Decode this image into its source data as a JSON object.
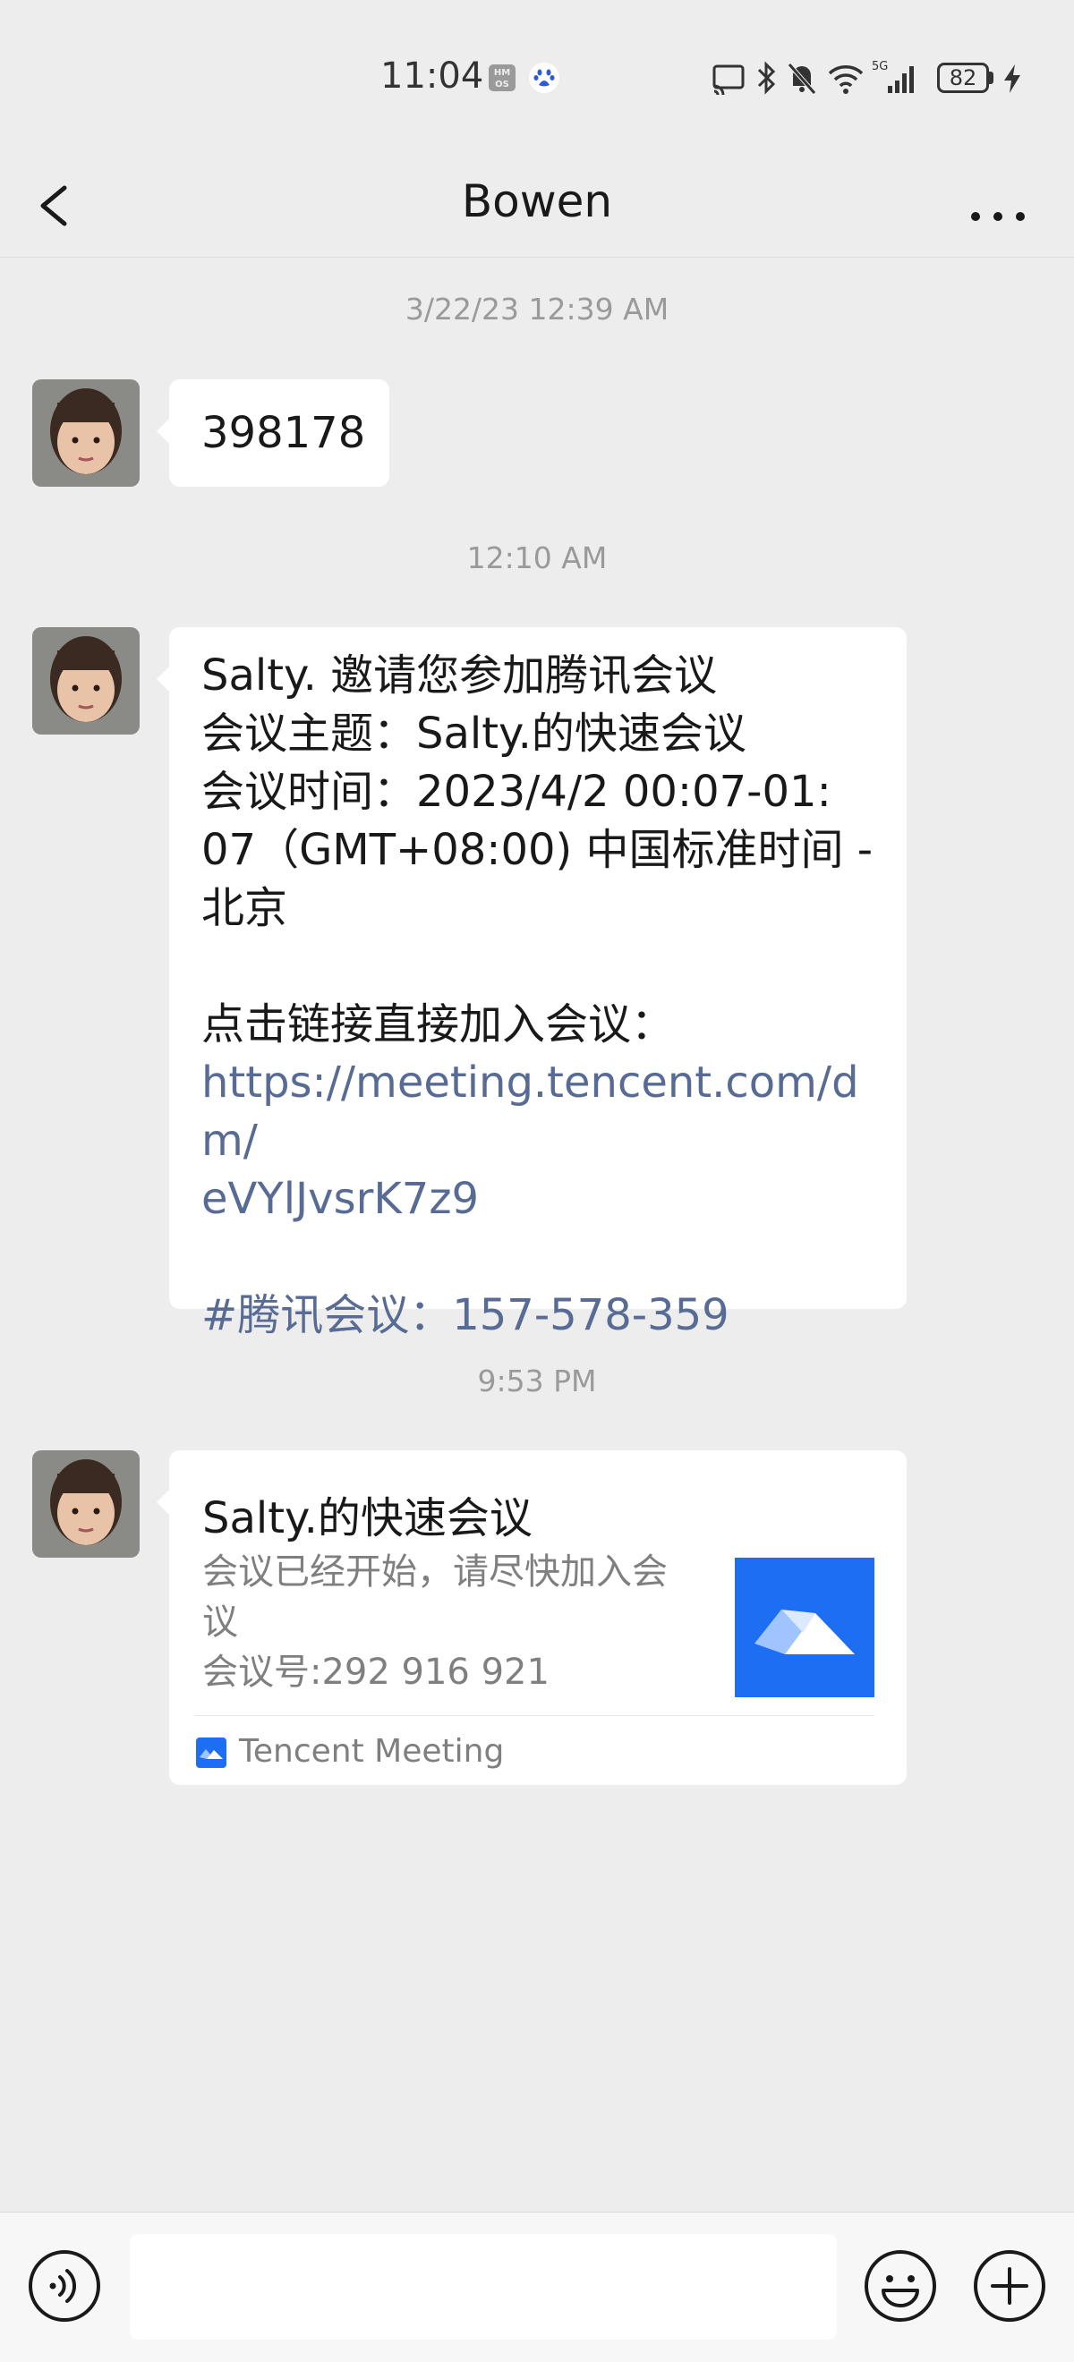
{
  "status_bar": {
    "time": "11:04",
    "hm_badge": "HM OS",
    "battery": "82"
  },
  "header": {
    "title": "Bowen"
  },
  "messages": [
    {
      "timestamp": "3/22/23 12:39 AM",
      "text": "398178"
    },
    {
      "timestamp": "12:10 AM",
      "lines": [
        "Salty. 邀请您参加腾讯会议",
        "会议主题：Salty.的快速会议",
        "会议时间：2023/4/2 00:07-01:",
        "07（GMT+08:00) 中国标准时间 -",
        "北京",
        "",
        "点击链接直接加入会议："
      ],
      "link_lines": [
        "https://meeting.tencent.com/dm/",
        "eVYlJvsrK7z9"
      ],
      "meeting_tag": "#腾讯会议：157-578-359"
    },
    {
      "timestamp": "9:53 PM",
      "card": {
        "title": "Salty.的快速会议",
        "desc_lines": [
          "会议已经开始，请尽快加入会",
          "议",
          "会议号:292 916 921"
        ],
        "source": "Tencent Meeting"
      }
    }
  ],
  "input_bar": {
    "placeholder": ""
  },
  "colors": {
    "background": "#ededed",
    "link": "#576b95",
    "tencent_blue": "#1d6ef2"
  }
}
